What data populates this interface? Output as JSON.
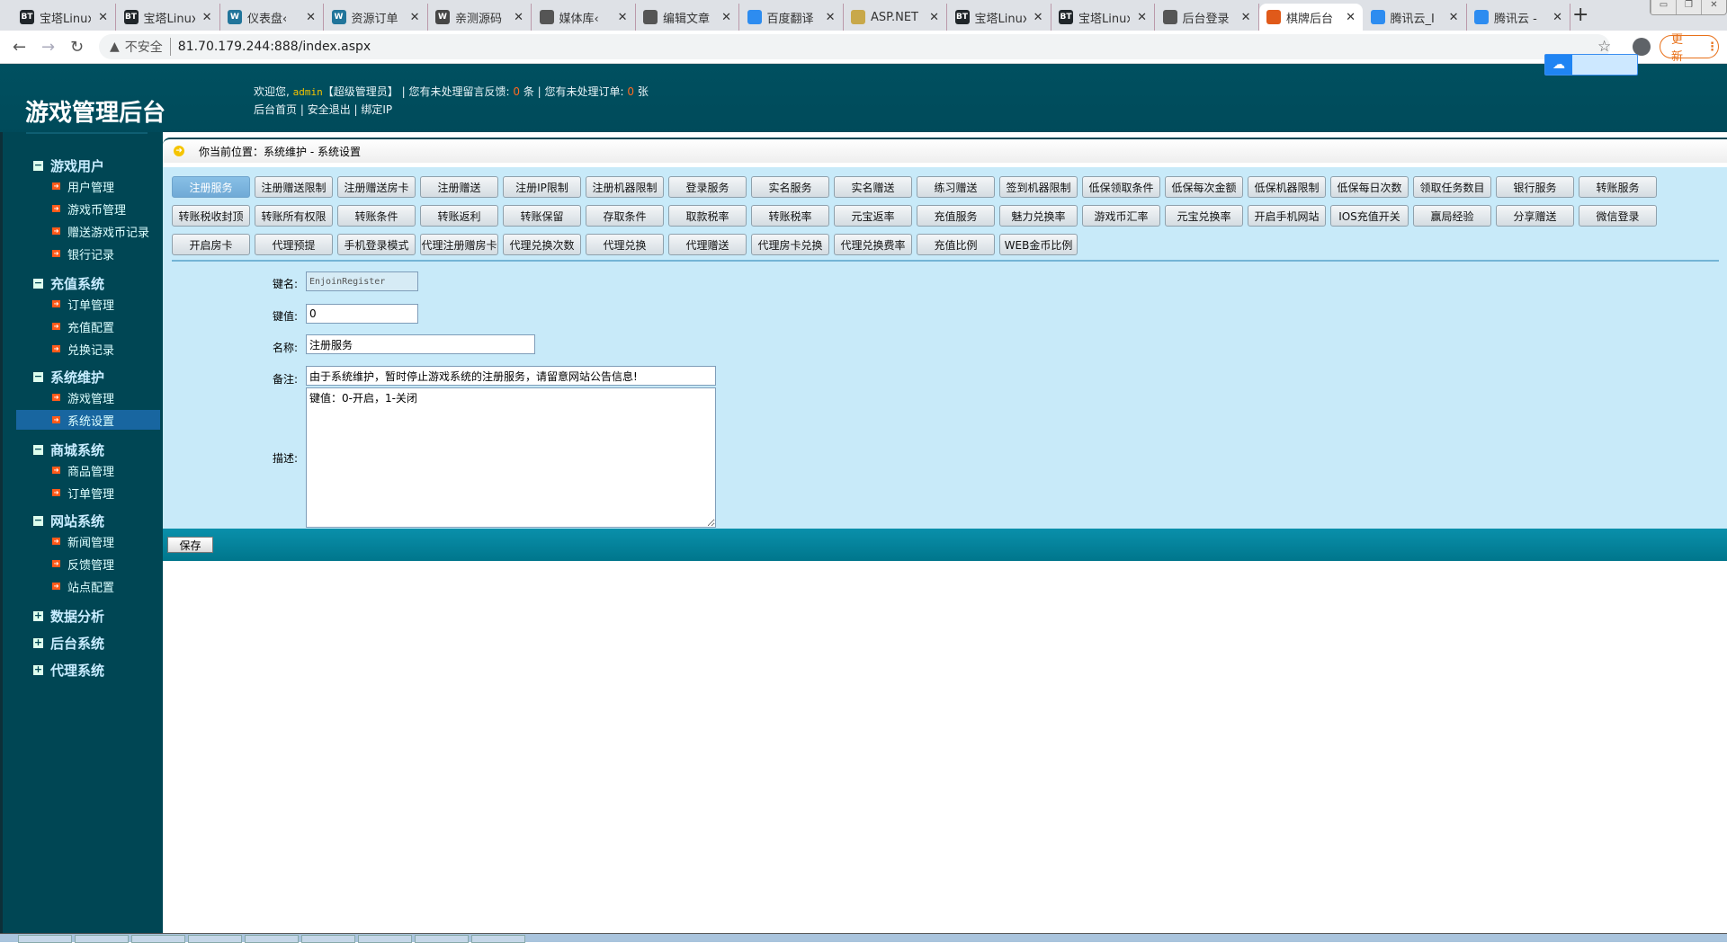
{
  "browser": {
    "tabs": [
      {
        "title": "宝塔Linux",
        "icon": "bt-icon",
        "color": "#20262a"
      },
      {
        "title": "宝塔Linux",
        "icon": "bt-icon",
        "color": "#20262a"
      },
      {
        "title": "仪表盘‹",
        "icon": "wordpress-icon",
        "color": "#21759b"
      },
      {
        "title": "资源订单",
        "icon": "wordpress-icon",
        "color": "#21759b"
      },
      {
        "title": "亲测源码",
        "icon": "wordpress-icon",
        "color": "#464646"
      },
      {
        "title": "媒体库‹",
        "icon": "globe-icon",
        "color": "#555"
      },
      {
        "title": "编辑文章",
        "icon": "globe-icon",
        "color": "#555"
      },
      {
        "title": "百度翻译",
        "icon": "translate-icon",
        "color": "#2d8cf0"
      },
      {
        "title": "ASP.NET",
        "icon": "aspnet-icon",
        "color": "#c8a84a"
      },
      {
        "title": "宝塔Linux",
        "icon": "bt-icon",
        "color": "#20262a"
      },
      {
        "title": "宝塔Linux",
        "icon": "bt-icon",
        "color": "#20262a"
      },
      {
        "title": "后台登录",
        "icon": "globe-icon",
        "color": "#555"
      },
      {
        "title": "棋牌后台",
        "icon": "game-icon",
        "color": "#e05a1a",
        "active": true
      },
      {
        "title": "腾讯云_I",
        "icon": "paw-icon",
        "color": "#2d8cf0"
      },
      {
        "title": "腾讯云 -",
        "icon": "cloud-icon",
        "color": "#2d8cf0"
      }
    ],
    "security_label": "不安全",
    "url": "81.70.179.244:888/index.aspx",
    "update_label": "更新"
  },
  "header": {
    "title": "游戏管理后台",
    "welcome_prefix": "欢迎您,",
    "username": "admin",
    "role": "【超级管理员】",
    "feedback_label": "| 您有未处理留言反馈:",
    "feedback_count": "0",
    "feedback_unit": "条",
    "orders_label": "| 您有未处理订单:",
    "orders_count": "0",
    "orders_unit": "张",
    "links": [
      "后台首页",
      "安全退出",
      "绑定IP"
    ]
  },
  "sidebar": [
    {
      "label": "游戏用户",
      "expanded": true,
      "items": [
        "用户管理",
        "游戏币管理",
        "赠送游戏币记录",
        "银行记录"
      ]
    },
    {
      "label": "充值系统",
      "expanded": true,
      "items": [
        "订单管理",
        "充值配置",
        "兑换记录"
      ]
    },
    {
      "label": "系统维护",
      "expanded": true,
      "items": [
        "游戏管理",
        "系统设置"
      ],
      "selected": "系统设置"
    },
    {
      "label": "商城系统",
      "expanded": true,
      "items": [
        "商品管理",
        "订单管理"
      ]
    },
    {
      "label": "网站系统",
      "expanded": true,
      "items": [
        "新闻管理",
        "反馈管理",
        "站点配置"
      ]
    },
    {
      "label": "数据分析",
      "expanded": false,
      "items": []
    },
    {
      "label": "后台系统",
      "expanded": false,
      "items": []
    },
    {
      "label": "代理系统",
      "expanded": false,
      "items": []
    }
  ],
  "breadcrumb": "你当前位置：系统维护 - 系统设置",
  "config_buttons": [
    "注册服务",
    "注册赠送限制",
    "注册赠送房卡",
    "注册赠送",
    "注册IP限制",
    "注册机器限制",
    "登录服务",
    "实名服务",
    "实名赠送",
    "练习赠送",
    "签到机器限制",
    "低保领取条件",
    "低保每次金额",
    "低保机器限制",
    "低保每日次数",
    "领取任务数目",
    "银行服务",
    "转账服务",
    "转账税收封顶",
    "转账所有权限",
    "转账条件",
    "转账返利",
    "转账保留",
    "存取条件",
    "取款税率",
    "转账税率",
    "元宝返率",
    "充值服务",
    "魅力兑换率",
    "游戏币汇率",
    "元宝兑换率",
    "开启手机网站",
    "IOS充值开关",
    "赢局经验",
    "分享赠送",
    "微信登录",
    "开启房卡",
    "代理预提",
    "手机登录模式",
    "代理注册赠房卡",
    "代理兑换次数",
    "代理兑换",
    "代理赠送",
    "代理房卡兑换",
    "代理兑换费率",
    "充值比例",
    "WEB金币比例"
  ],
  "active_button": "注册服务",
  "form": {
    "key_name_label": "键名:",
    "key_name_value": "EnjoinRegister",
    "key_value_label": "键值:",
    "key_value_value": "0",
    "name_label": "名称:",
    "name_value": "注册服务",
    "note_label": "备注:",
    "note_value": "由于系统维护，暂时停止游戏系统的注册服务，请留意网站公告信息!",
    "desc_label": "描述:",
    "desc_value": "键值：0-开启，1-关闭",
    "save_label": "保存"
  }
}
